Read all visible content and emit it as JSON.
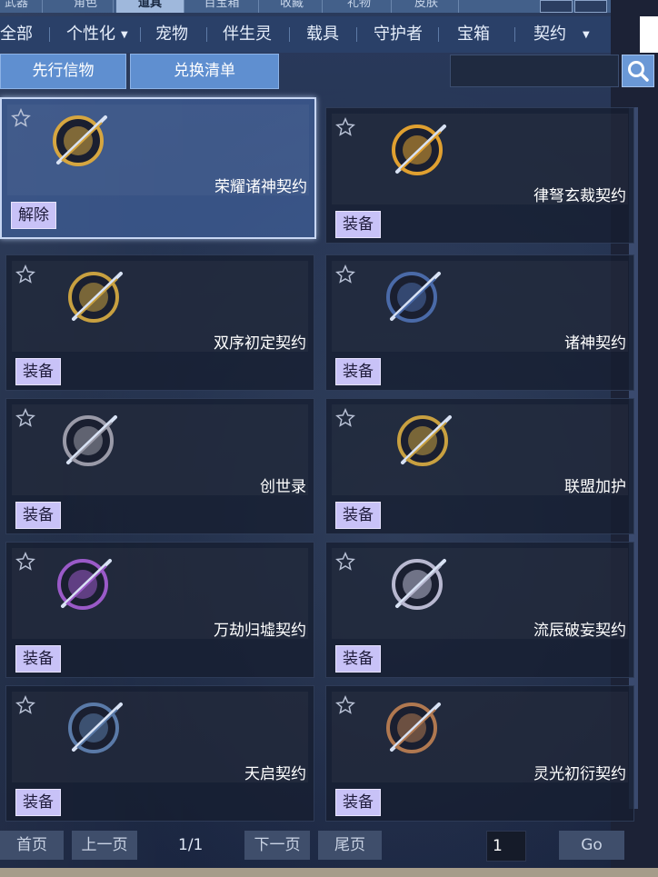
{
  "top_tabs": [
    {
      "label": "武器",
      "active": false
    },
    {
      "label": "角色",
      "active": false
    },
    {
      "label": "道具",
      "active": true
    },
    {
      "label": "百宝箱",
      "active": false
    },
    {
      "label": "收藏",
      "active": false
    },
    {
      "label": "礼物",
      "active": false
    },
    {
      "label": "皮肤",
      "active": false
    }
  ],
  "categories": [
    {
      "label": "全部",
      "has_dropdown": false
    },
    {
      "label": "个性化",
      "has_dropdown": true
    },
    {
      "label": "宠物",
      "has_dropdown": false
    },
    {
      "label": "伴生灵",
      "has_dropdown": false
    },
    {
      "label": "载具",
      "has_dropdown": false
    },
    {
      "label": "守护者",
      "has_dropdown": false
    },
    {
      "label": "宝箱",
      "has_dropdown": false
    },
    {
      "label": "契约",
      "has_dropdown": true
    }
  ],
  "sub_buttons": {
    "first": "先行信物",
    "second": "兑换清单"
  },
  "search": {
    "value": ""
  },
  "items": [
    {
      "name": "荣耀诸神契约",
      "action": "解除",
      "selected": true,
      "emblem": "crossed-swords-wings-icon",
      "color": "#d6a640"
    },
    {
      "name": "律弩玄裁契约",
      "action": "装备",
      "selected": false,
      "emblem": "crossbow-medal-icon",
      "color": "#e0a030"
    },
    {
      "name": "双序初定契约",
      "action": "装备",
      "selected": false,
      "emblem": "rifle-medal-icon",
      "color": "#c8a040"
    },
    {
      "name": "诸神契约",
      "action": "装备",
      "selected": false,
      "emblem": "sniper-wings-icon",
      "color": "#4a6aa8"
    },
    {
      "name": "创世录",
      "action": "装备",
      "selected": false,
      "emblem": "hourglass-wings-icon",
      "color": "#9a9aa8"
    },
    {
      "name": "联盟加护",
      "action": "装备",
      "selected": false,
      "emblem": "helmet-shield-icon",
      "color": "#c8a040"
    },
    {
      "name": "万劫归墟契约",
      "action": "装备",
      "selected": false,
      "emblem": "spiked-medal-icon",
      "color": "#9a5ac8"
    },
    {
      "name": "流辰破妄契约",
      "action": "装备",
      "selected": false,
      "emblem": "silver-crossbow-icon",
      "color": "#b8b8d0"
    },
    {
      "name": "天启契约",
      "action": "装备",
      "selected": false,
      "emblem": "purple-orb-emblem-icon",
      "color": "#5a7aa8"
    },
    {
      "name": "灵光初衍契约",
      "action": "装备",
      "selected": false,
      "emblem": "bronze-rifle-medal-icon",
      "color": "#b07850"
    }
  ],
  "pager": {
    "first": "首页",
    "prev": "上一页",
    "info": "1/1",
    "next": "下一页",
    "last": "尾页",
    "page_value": "1",
    "go": "Go"
  }
}
